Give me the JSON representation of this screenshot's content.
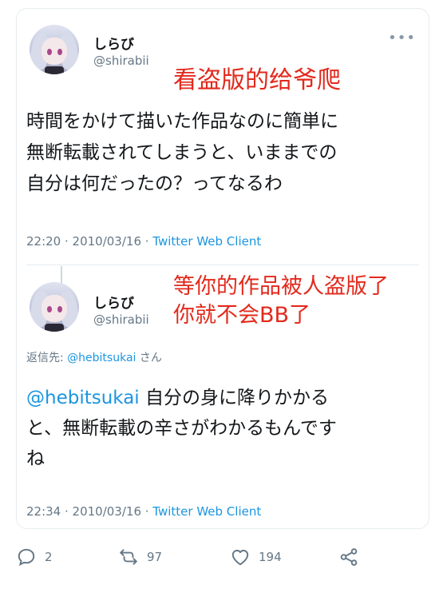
{
  "tweet1": {
    "display_name": "しらび",
    "handle": "@shirabii",
    "more_icon": "more-icon",
    "overlay_text": "看盗版的给爷爬",
    "text_lines": [
      "時間をかけて描いた作品なのに簡単に",
      "無断転載されてしまうと、いままでの",
      "自分は何だったの？ってなるわ"
    ],
    "time": "22:20 · 2010/03/16 · ",
    "client": "Twitter Web Client"
  },
  "tweet2": {
    "display_name": "しらび",
    "handle": "@shirabii",
    "overlay_lines": [
      "等你的作品被人盗版了",
      "你就不会BB了"
    ],
    "reply_prefix": "返信先: ",
    "reply_mention": "@hebitsukai",
    "reply_suffix": " さん",
    "mention": "@hebitsukai",
    "text_rest_line1": " 自分の身に降りかかる",
    "text_lines": [
      "と、無断転載の辛さがわかるもんです",
      "ね"
    ],
    "time": "22:34 · 2010/03/16 · ",
    "client": "Twitter Web Client"
  },
  "actions": {
    "reply_count": "2",
    "retweet_count": "97",
    "like_count": "194"
  },
  "colors": {
    "accent": "#1b95e0",
    "overlay_red": "#e2291c",
    "secondary_text": "#657786"
  }
}
